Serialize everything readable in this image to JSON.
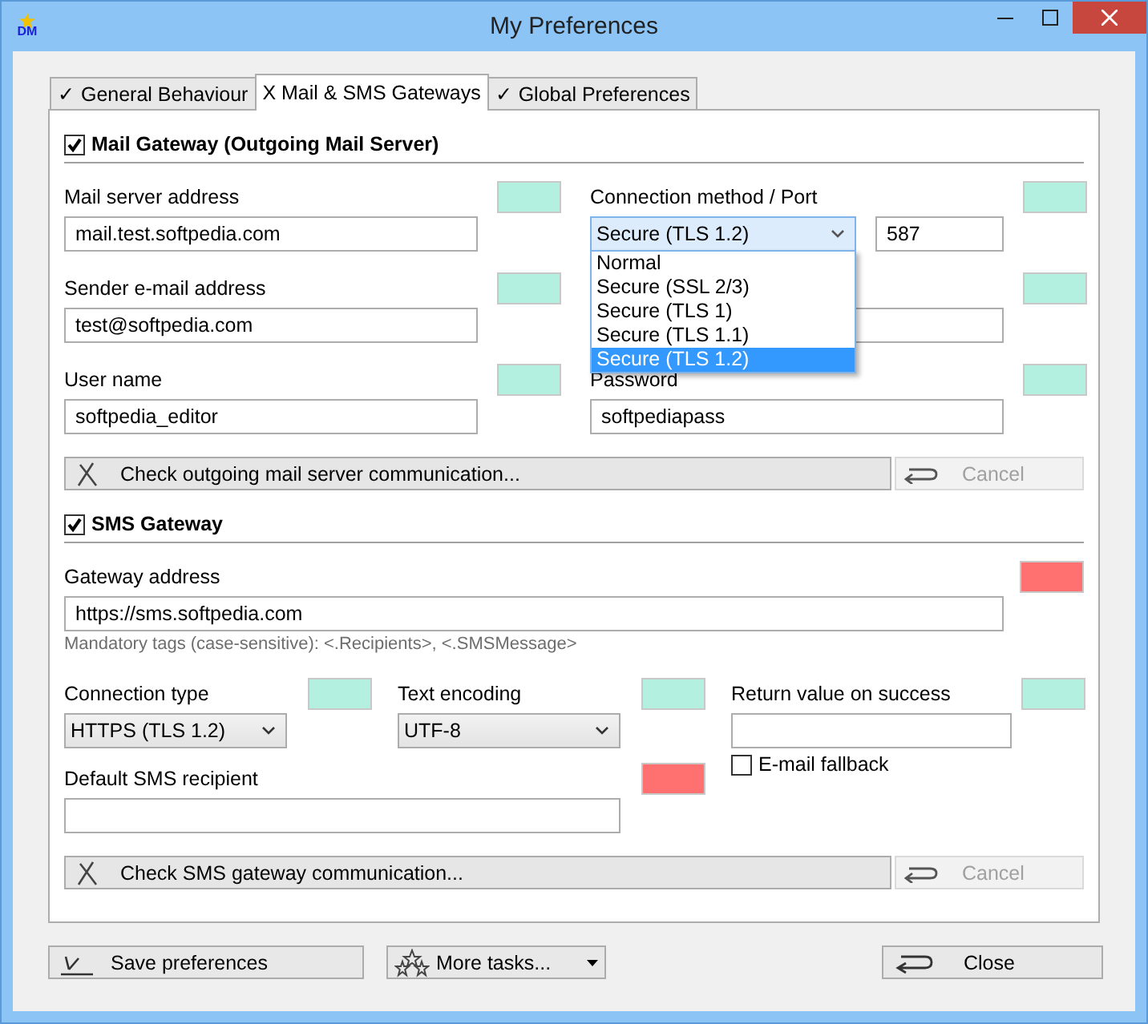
{
  "window": {
    "title": "My Preferences",
    "logo": "DM"
  },
  "tabs": [
    {
      "label": "✓ General Behaviour",
      "selected": false
    },
    {
      "label": "X Mail & SMS Gateways",
      "selected": true
    },
    {
      "label": "✓ Global Preferences",
      "selected": false
    }
  ],
  "mail_gateway": {
    "label": "Mail Gateway (Outgoing Mail Server)",
    "checked": true,
    "fields": [
      {
        "kind": "text",
        "label": "Mail server address",
        "value": "mail.test.softpedia.com",
        "color": "#b3f0e0"
      },
      {
        "kind": "select_port",
        "label": "Connection method / Port",
        "value": "Secure (TLS 1.2)",
        "port": "587",
        "color": "#b3f0e0",
        "expanded": true,
        "options": [
          {
            "label": "Normal",
            "selected": false
          },
          {
            "label": "Secure (SSL 2/3)",
            "selected": false
          },
          {
            "label": "Secure (TLS 1)",
            "selected": false
          },
          {
            "label": "Secure (TLS 1.1)",
            "selected": false
          },
          {
            "label": "Secure (TLS 1.2)",
            "selected": true
          }
        ]
      },
      {
        "kind": "text",
        "label": "Sender e-mail address",
        "value": "test@softpedia.com",
        "color": "#b3f0e0"
      },
      {
        "kind": "text",
        "color": "#b3f0e0"
      },
      {
        "kind": "text",
        "label": "User name",
        "value": "softpedia_editor",
        "color": "#b3f0e0"
      },
      {
        "kind": "text",
        "label": "Password",
        "value": "softpediapass",
        "color": "#b3f0e0"
      }
    ],
    "check_button": {
      "label": "Check outgoing mail server communication...",
      "cancel": "Cancel",
      "cancel_disabled": true
    }
  },
  "sms_gateway": {
    "label": "SMS Gateway",
    "checked": true,
    "gateway_address": {
      "label": "Gateway address",
      "value": "https://sms.softpedia.com",
      "color": "#ff7070",
      "hint": "Mandatory tags (case-sensitive): <.Recipients>, <.SMSMessage>"
    },
    "fields": [
      {
        "kind": "select",
        "label": "Connection type",
        "value": "HTTPS (TLS 1.2)",
        "color": "#b3f0e0"
      },
      {
        "kind": "select",
        "label": "Text encoding",
        "value": "UTF-8",
        "color": "#b3f0e0"
      },
      {
        "kind": "text",
        "label": "Return value on success",
        "color": "#b3f0e0"
      },
      {
        "kind": "text",
        "label": "Default SMS recipient",
        "color": "#ff7070"
      }
    ],
    "email_fallback": {
      "label": "E-mail fallback",
      "checked": false
    },
    "check_button": {
      "label": "Check SMS gateway communication...",
      "cancel": "Cancel",
      "cancel_disabled": true
    }
  },
  "buttons": [
    {
      "kind": "save",
      "label": "Save preferences"
    },
    {
      "kind": "more",
      "label": "More tasks..."
    },
    {
      "kind": "close",
      "label": "Close"
    }
  ]
}
